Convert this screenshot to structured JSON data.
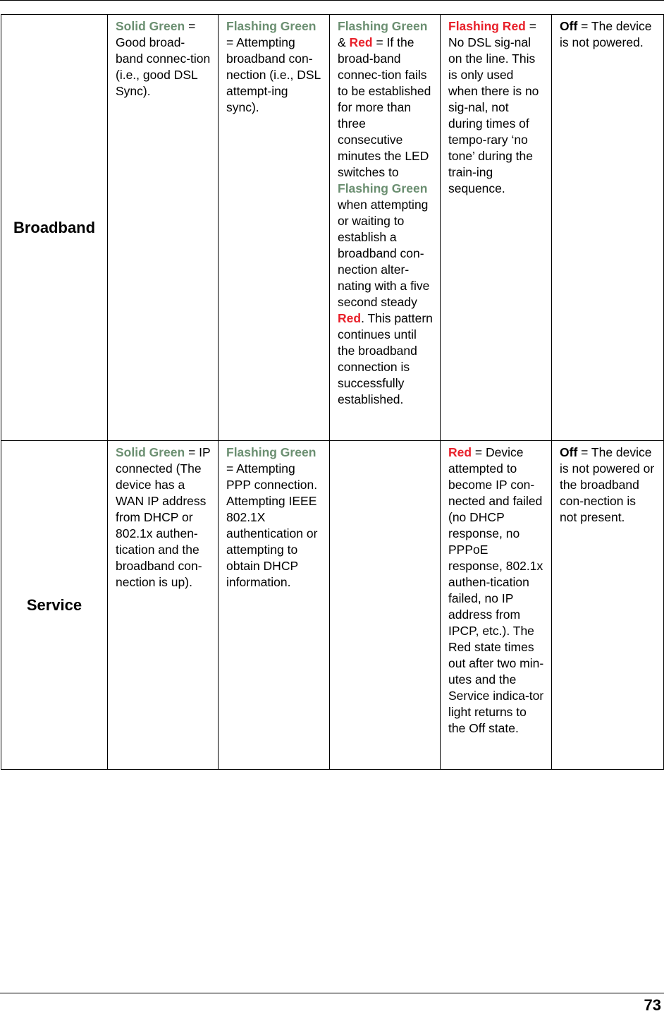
{
  "rows": [
    {
      "label": "Broadband",
      "cells": [
        {
          "lead": "Solid Green",
          "lead_color": "green",
          "text": " = Good broad-band connec-tion (i.e., good DSL Sync)."
        },
        {
          "lead": "Flashing Green",
          "lead_color": "green",
          "text": " = Attempting broadband con-nection (i.e., DSL attempt-ing sync)."
        },
        {
          "parts": [
            {
              "t": "Flashing Green",
              "c": "green"
            },
            {
              "t": " & ",
              "c": ""
            },
            {
              "t": "Red",
              "c": "red"
            },
            {
              "t": " = If the broad-band connec-tion fails to be established for more than three consecutive minutes the LED switches to ",
              "c": ""
            },
            {
              "t": "Flashing Green",
              "c": "green"
            },
            {
              "t": " when attempting or waiting to establish a broadband con-nection alter-nating with a five second steady ",
              "c": ""
            },
            {
              "t": "Red",
              "c": "red"
            },
            {
              "t": ". This pattern continues until the broadband connection is successfully established.",
              "c": ""
            }
          ]
        },
        {
          "lead": "Flashing Red",
          "lead_color": "red",
          "text": " = No DSL sig-nal on the line. This is only used when there is no sig-nal, not during times of tempo-rary ‘no tone’ during the train-ing sequence."
        },
        {
          "lead": "Off",
          "lead_color": "black",
          "text": " = The device is not powered."
        }
      ]
    },
    {
      "label": "Service",
      "cells": [
        {
          "lead": "Solid Green",
          "lead_color": "green",
          "text": " = IP connected (The device has a WAN IP address from DHCP or 802.1x authen-tication and the broadband con-nection is up)."
        },
        {
          "lead": "Flashing Green",
          "lead_color": "green",
          "text": " = Attempting PPP connection. Attempting IEEE 802.1X authentication or attempting to obtain DHCP information."
        },
        {
          "lead": "",
          "lead_color": "",
          "text": ""
        },
        {
          "lead": "Red",
          "lead_color": "red",
          "text": " = Device attempted to become IP con-nected and failed (no DHCP response, no PPPoE response, 802.1x authen-tication failed, no IP address from IPCP, etc.). The Red state times out after two min-utes and the Service indica-tor light returns to the Off state."
        },
        {
          "lead": "Off",
          "lead_color": "black",
          "text": " = The device is not powered or the broadband con-nection is not present."
        }
      ]
    }
  ],
  "colors": {
    "green": "#6b8f71",
    "red": "#e8202a"
  },
  "page_number": "73"
}
